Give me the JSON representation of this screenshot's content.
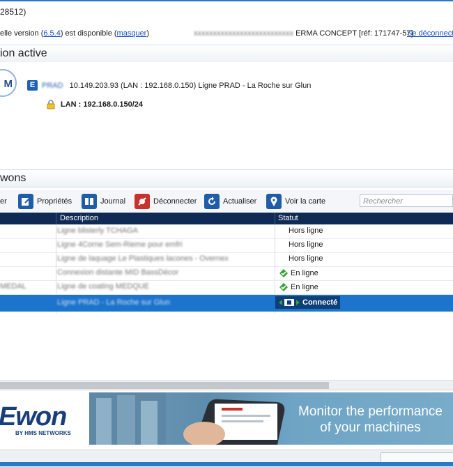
{
  "window": {
    "title_fragment": " 28512)"
  },
  "update_bar": {
    "text_prefix": "elle version (",
    "version": "6.5.4",
    "text_mid": ") est disponible (",
    "hide_link": "masquer",
    "text_suffix": ")",
    "account_blurred": "xxxxxxxxxxxxxxxxxxxxxxxxxx",
    "account": "ERMA CONCEPT [réf: 171747-57]",
    "logout_link": "Se déconnect"
  },
  "active_connection": {
    "section_title": "ion active",
    "logo_letter": "M",
    "badge_letter": "E",
    "device_name_blurred": "PRAD",
    "device_info": "10.149.203.93 (LAN : 192.168.0.150)   Ligne PRAD - La Roche sur Glun",
    "lan_label": "LAN : 192.168.0.150/24"
  },
  "ewons": {
    "section_title": "wons",
    "toolbar": {
      "first_label": "er",
      "properties": "Propriétés",
      "journal": "Journal",
      "disconnect": "Déconnecter",
      "refresh": "Actualiser",
      "map": "Voir la carte"
    },
    "search_placeholder": "Rechercher",
    "columns": {
      "description": "Description",
      "status": "Statut"
    },
    "rows": [
      {
        "name": "",
        "description": "Ligne blisterly TCHAGA",
        "status": "Hors ligne",
        "state": "offline"
      },
      {
        "name": "",
        "description": "Ligne 4Corne Sem-Rieme pour emfri",
        "status": "Hors ligne",
        "state": "offline"
      },
      {
        "name": "",
        "description": "Ligne de laquage Le Plastiques lacones - Overnex",
        "status": "Hors ligne",
        "state": "offline"
      },
      {
        "name": "",
        "description": "Connexion distante MID BassDécor",
        "status": "En ligne",
        "state": "online"
      },
      {
        "name": "MEDAL",
        "description": "Ligne de coating MEDQUE",
        "status": "En ligne",
        "state": "online"
      },
      {
        "name": "",
        "description": "Ligne PRAD - La Roche sur Glun",
        "status": "Connecté",
        "state": "connected"
      }
    ]
  },
  "banner": {
    "brand": "Ewon",
    "brand_sub": "BY HMS NETWORKS",
    "tagline_1": "Monitor the performance",
    "tagline_2": "of your machines"
  },
  "colors": {
    "accent": "#2b78c8",
    "header_dark": "#0f2a55",
    "selection": "#1c74cc",
    "online_green": "#3aa03a"
  }
}
